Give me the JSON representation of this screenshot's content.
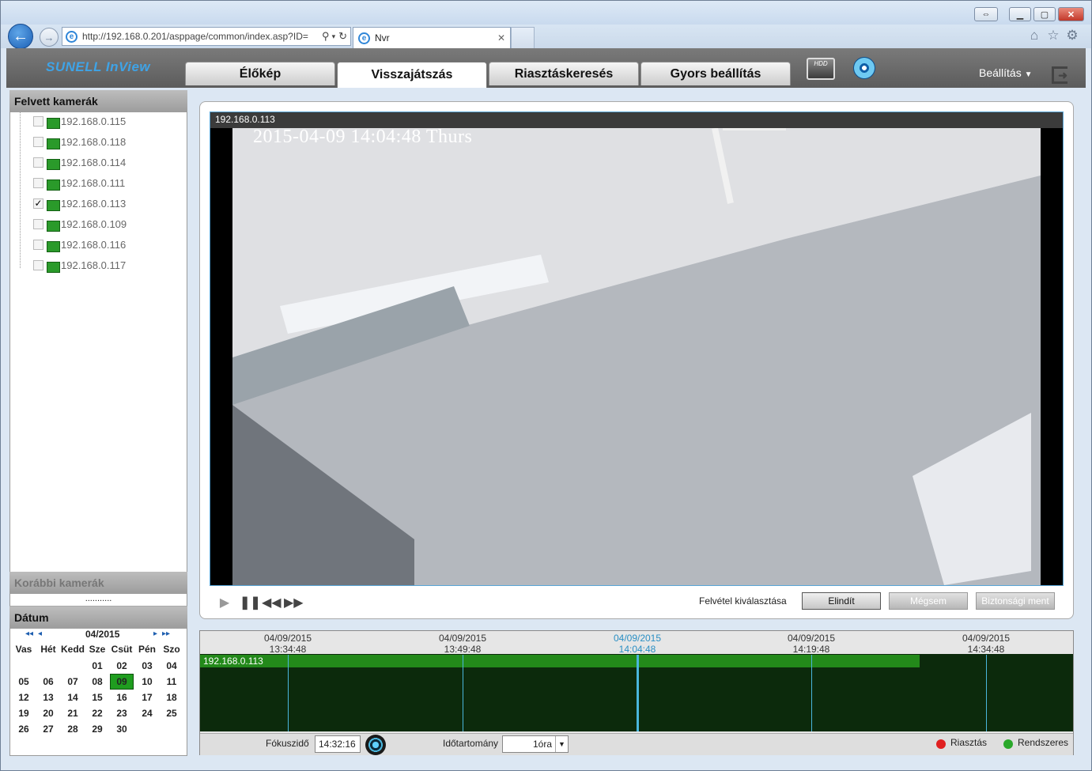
{
  "browser": {
    "url": "http://192.168.0.201/asppage/common/index.asp?ID=",
    "tab_title": "Nvr"
  },
  "app": {
    "logo": "SUNELL InView",
    "tabs": [
      "Élőkép",
      "Visszajátszás",
      "Riasztáskeresés",
      "Gyors beállítás"
    ],
    "active_tab": "Visszajátszás",
    "hdd_label": "HDD",
    "settings_label": "Beállítás"
  },
  "left": {
    "cameras_header": "Felvett kamerák",
    "cameras": [
      {
        "ip": "192.168.0.115",
        "checked": false,
        "check_mark": ""
      },
      {
        "ip": "192.168.0.118",
        "checked": false,
        "check_mark": ""
      },
      {
        "ip": "192.168.0.114",
        "checked": false,
        "check_mark": ""
      },
      {
        "ip": "192.168.0.111",
        "checked": false,
        "check_mark": ""
      },
      {
        "ip": "192.168.0.113",
        "checked": true,
        "check_mark": "✓"
      },
      {
        "ip": "192.168.0.109",
        "checked": false,
        "check_mark": ""
      },
      {
        "ip": "192.168.0.116",
        "checked": false,
        "check_mark": ""
      },
      {
        "ip": "192.168.0.117",
        "checked": false,
        "check_mark": ""
      }
    ],
    "previous_header": "Korábbi kamerák",
    "previous_placeholder": "...........",
    "date_header": "Dátum"
  },
  "calendar": {
    "month_label": "04/2015",
    "prev_year": "◂◂",
    "prev_month": "◂",
    "next_month": "▸",
    "next_year": "▸▸",
    "weekdays": [
      "Vas",
      "Hét",
      "Kedd",
      "Sze",
      "Csüt",
      "Pén",
      "Szo"
    ],
    "weeks": [
      [
        "",
        "",
        "",
        "01",
        "02",
        "03",
        "04"
      ],
      [
        "05",
        "06",
        "07",
        "08",
        "09",
        "10",
        "11"
      ],
      [
        "12",
        "13",
        "14",
        "15",
        "16",
        "17",
        "18"
      ],
      [
        "19",
        "20",
        "21",
        "22",
        "23",
        "24",
        "25"
      ],
      [
        "26",
        "27",
        "28",
        "29",
        "30",
        "",
        ""
      ]
    ],
    "selected": "09",
    "selected_color": "#1f9d1f"
  },
  "player": {
    "camera_title": "192.168.0.113",
    "osd_text": "2015-04-09 14:04:48 Thurs",
    "select_recording_label": "Felvétel kiválasztása",
    "start_button": "Elindít",
    "cancel_button": "Mégsem",
    "backup_button": "Biztonsági ment"
  },
  "timeline": {
    "ticks": [
      {
        "date": "04/09/2015",
        "time": "13:34:48",
        "active": false
      },
      {
        "date": "04/09/2015",
        "time": "13:49:48",
        "active": false
      },
      {
        "date": "04/09/2015",
        "time": "14:04:48",
        "active": true
      },
      {
        "date": "04/09/2015",
        "time": "14:19:48",
        "active": false
      },
      {
        "date": "04/09/2015",
        "time": "14:34:48",
        "active": false
      }
    ],
    "track_label": "192.168.0.113",
    "recorded_fraction": 0.824,
    "focus_label": "Fókuszidő",
    "focus_value": "14:32:16",
    "range_label": "Időtartomány",
    "range_value": "1óra",
    "legend": [
      {
        "label": "Riasztás",
        "color": "#e02020"
      },
      {
        "label": "Rendszeres",
        "color": "#2aa82a"
      }
    ]
  }
}
